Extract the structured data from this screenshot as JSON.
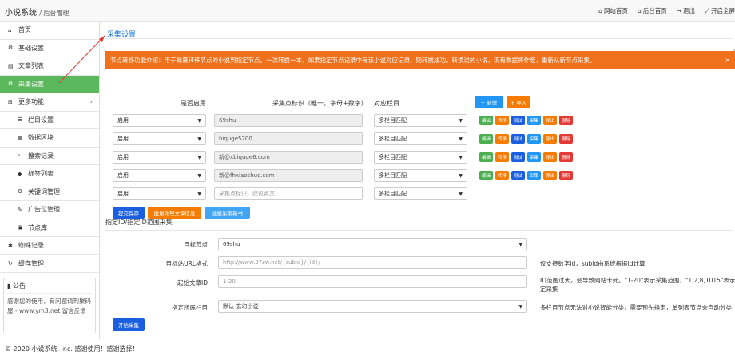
{
  "header": {
    "brand": "小说系统",
    "brand_sub": "/ 后台管理",
    "nav": [
      {
        "icon": "home-icon",
        "glyph": "⌂",
        "label": "网站首页"
      },
      {
        "icon": "home-icon",
        "glyph": "⌂",
        "label": "后台首页"
      },
      {
        "icon": "logout-icon",
        "glyph": "↪",
        "label": "退出"
      },
      {
        "icon": "fullscreen-icon",
        "glyph": "⤢",
        "label": "开启全屏"
      }
    ]
  },
  "sidebar": {
    "items": [
      {
        "glyph": "⌂",
        "label": "首页"
      },
      {
        "glyph": "⚙",
        "label": "基础设置"
      },
      {
        "glyph": "▤",
        "label": "文章列表"
      },
      {
        "glyph": "⚙",
        "label": "采集设置",
        "active": true
      },
      {
        "glyph": "⊞",
        "label": "更多功能",
        "chevron": "›"
      },
      {
        "glyph": "☰",
        "label": "栏目设置",
        "sub": true
      },
      {
        "glyph": "▦",
        "label": "数据区块",
        "sub": true
      },
      {
        "glyph": "⌕",
        "label": "搜索记录",
        "sub": true
      },
      {
        "glyph": "◆",
        "label": "标签列表",
        "sub": true
      },
      {
        "glyph": "⚙",
        "label": "关键词管理",
        "sub": true
      },
      {
        "glyph": "✎",
        "label": "广告位管理",
        "sub": true
      },
      {
        "glyph": "▣",
        "label": "节点库",
        "sub": true
      },
      {
        "glyph": "✱",
        "label": "蜘蛛记录"
      },
      {
        "glyph": "↻",
        "label": "缓存管理"
      }
    ],
    "notice_title": "公告",
    "notice_body": "感谢您的使用，有问题请到聚码屋 - www.ym3.net 留言反馈"
  },
  "main": {
    "title": "采集设置",
    "alert": "节点转移功能介绍：用于批量转移节点的小说到指定节点。一次转换一本，如果指定节点记录中有该小说对应记录，则转换成功。转换过的小说，现有数据将作废，重新从新节点采集。",
    "alert_close": "×",
    "col_enable": "是否启用",
    "col_node": "采集点标识（唯一，字母+数字）",
    "col_category": "对应栏目",
    "btn_add": "+ 新增",
    "btn_import": "+ 导入",
    "rows": [
      {
        "enable": "启用",
        "node": "69shu",
        "category": "多栏目匹配"
      },
      {
        "enable": "启用",
        "node": "biquge5200",
        "category": "多栏目匹配"
      },
      {
        "enable": "启用",
        "node": "新@xbiquge6.com",
        "category": "多栏目匹配"
      },
      {
        "enable": "启用",
        "node": "新@fhxiaoshuo.com",
        "category": "多栏目匹配"
      },
      {
        "enable": "启用",
        "node": "",
        "placeholder": "采集点标识，建议英文",
        "category": "多栏目匹配"
      }
    ],
    "row_actions": [
      "编辑",
      "转移",
      "测试",
      "采集",
      "导出",
      "删除"
    ],
    "btn_submit": "提交保存",
    "btn_batch": "批量处理文章信息",
    "btn_batch_update": "批量采集新书",
    "section2_title": "指定ID/指定ID范围采集",
    "form": {
      "target_label": "目标节点",
      "target_value": "69shu",
      "url_label": "目标站URL格式",
      "url_placeholder": "http://www.37zw.net/{subid}/{id}/",
      "url_hint": "仅支持数字id，subid由系统根据id计算",
      "start_label": "起始文章ID",
      "start_placeholder": "1-20",
      "start_hint1": "ID范围过大，会导致网站卡死。\"1-20\"表示采集范围，\"1,2,8,1015\"表示指",
      "start_hint2": "定采集",
      "cat_label": "指定所属栏目",
      "cat_value": "默认-玄幻小说",
      "cat_hint": "多栏目节点无法对小说智能分类，需要预先指定，单列表节点会自动分类",
      "btn_start": "开始采集"
    }
  },
  "footer": "© 2020 小说系统, Inc. 感谢使用！感谢选择！",
  "colors": {
    "accent": "#5cb85c",
    "alert": "#f0711c",
    "link": "#1976d2"
  }
}
